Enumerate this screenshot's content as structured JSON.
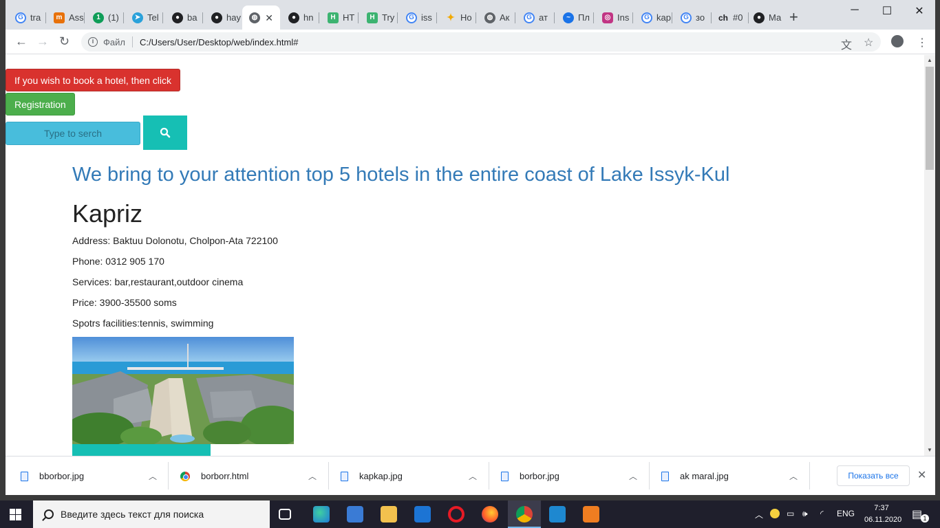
{
  "browser": {
    "tabs": [
      {
        "favicon": "google-icon",
        "label": "tra",
        "color": "#4285f4"
      },
      {
        "favicon": "m-icon",
        "label": "Ass",
        "color": "#e8710a"
      },
      {
        "favicon": "one-icon",
        "label": "(1)",
        "color": "#0f9d58"
      },
      {
        "favicon": "telegram-icon",
        "label": "Tel",
        "color": "#2aa1da"
      },
      {
        "favicon": "github-icon",
        "label": "ba",
        "color": "#202124"
      },
      {
        "favicon": "github-icon",
        "label": "hay",
        "color": "#202124"
      },
      {
        "favicon": "globe-icon",
        "label": "",
        "color": "#5f6368",
        "active": true
      },
      {
        "favicon": "github-icon",
        "label": "hn",
        "color": "#202124"
      },
      {
        "favicon": "h-icon",
        "label": "HT",
        "color": "#3cb371"
      },
      {
        "favicon": "h-icon",
        "label": "Try",
        "color": "#3cb371"
      },
      {
        "favicon": "google-icon",
        "label": "iss",
        "color": "#4285f4"
      },
      {
        "favicon": "sparkle-icon",
        "label": "Ho",
        "color": "#f2a900"
      },
      {
        "favicon": "globe-icon",
        "label": "Ак",
        "color": "#5f6368"
      },
      {
        "favicon": "google-icon",
        "label": "ат",
        "color": "#4285f4"
      },
      {
        "favicon": "swan-icon",
        "label": "Пл",
        "color": "#1a73e8"
      },
      {
        "favicon": "instagram-icon",
        "label": "Ins",
        "color": "#c13584"
      },
      {
        "favicon": "google-icon",
        "label": "kap",
        "color": "#4285f4"
      },
      {
        "favicon": "google-icon",
        "label": "зо",
        "color": "#4285f4"
      },
      {
        "favicon": "ch-icon",
        "label": "#0",
        "color": "#202124"
      },
      {
        "favicon": "github-icon",
        "label": "Ма",
        "color": "#202124"
      }
    ],
    "address": {
      "scheme_label": "Файл",
      "url": "C:/Users/User/Desktop/web/index.html#"
    }
  },
  "page": {
    "book_button": "If you wish to book a hotel, then click",
    "registration_button": "Registration",
    "search_placeholder": "Type to serch",
    "headline": "We bring to your attention top 5 hotels in the entire coast of Lake Issyk-Kul",
    "hotel": {
      "name": "Kapriz",
      "address": "Address: Baktuu Dolonotu, Cholpon-Ata 722100",
      "phone": "Phone: 0312 905 170",
      "services": "Services: bar,restaurant,outdoor cinema",
      "price": "Price: 3900-35500 soms",
      "sports": "Spotrs facilities:tennis, swimming"
    },
    "colors": {
      "headline": "#337ab7",
      "danger_button": "#d9322e",
      "success_button": "#4cae4c",
      "search_field": "#48bddc",
      "teal": "#16bfb4"
    }
  },
  "downloads": {
    "items": [
      {
        "name": "bborbor.jpg",
        "icon": "file-icon"
      },
      {
        "name": "borborr.html",
        "icon": "chrome-icon"
      },
      {
        "name": "kapkap.jpg",
        "icon": "file-icon"
      },
      {
        "name": "borbor.jpg",
        "icon": "file-icon"
      },
      {
        "name": "ak maral.jpg",
        "icon": "file-icon"
      }
    ],
    "show_all": "Показать все"
  },
  "taskbar": {
    "search_placeholder": "Введите здесь текст для поиска",
    "language": "ENG",
    "time": "7:37",
    "date": "06.11.2020",
    "notifications": "1"
  }
}
